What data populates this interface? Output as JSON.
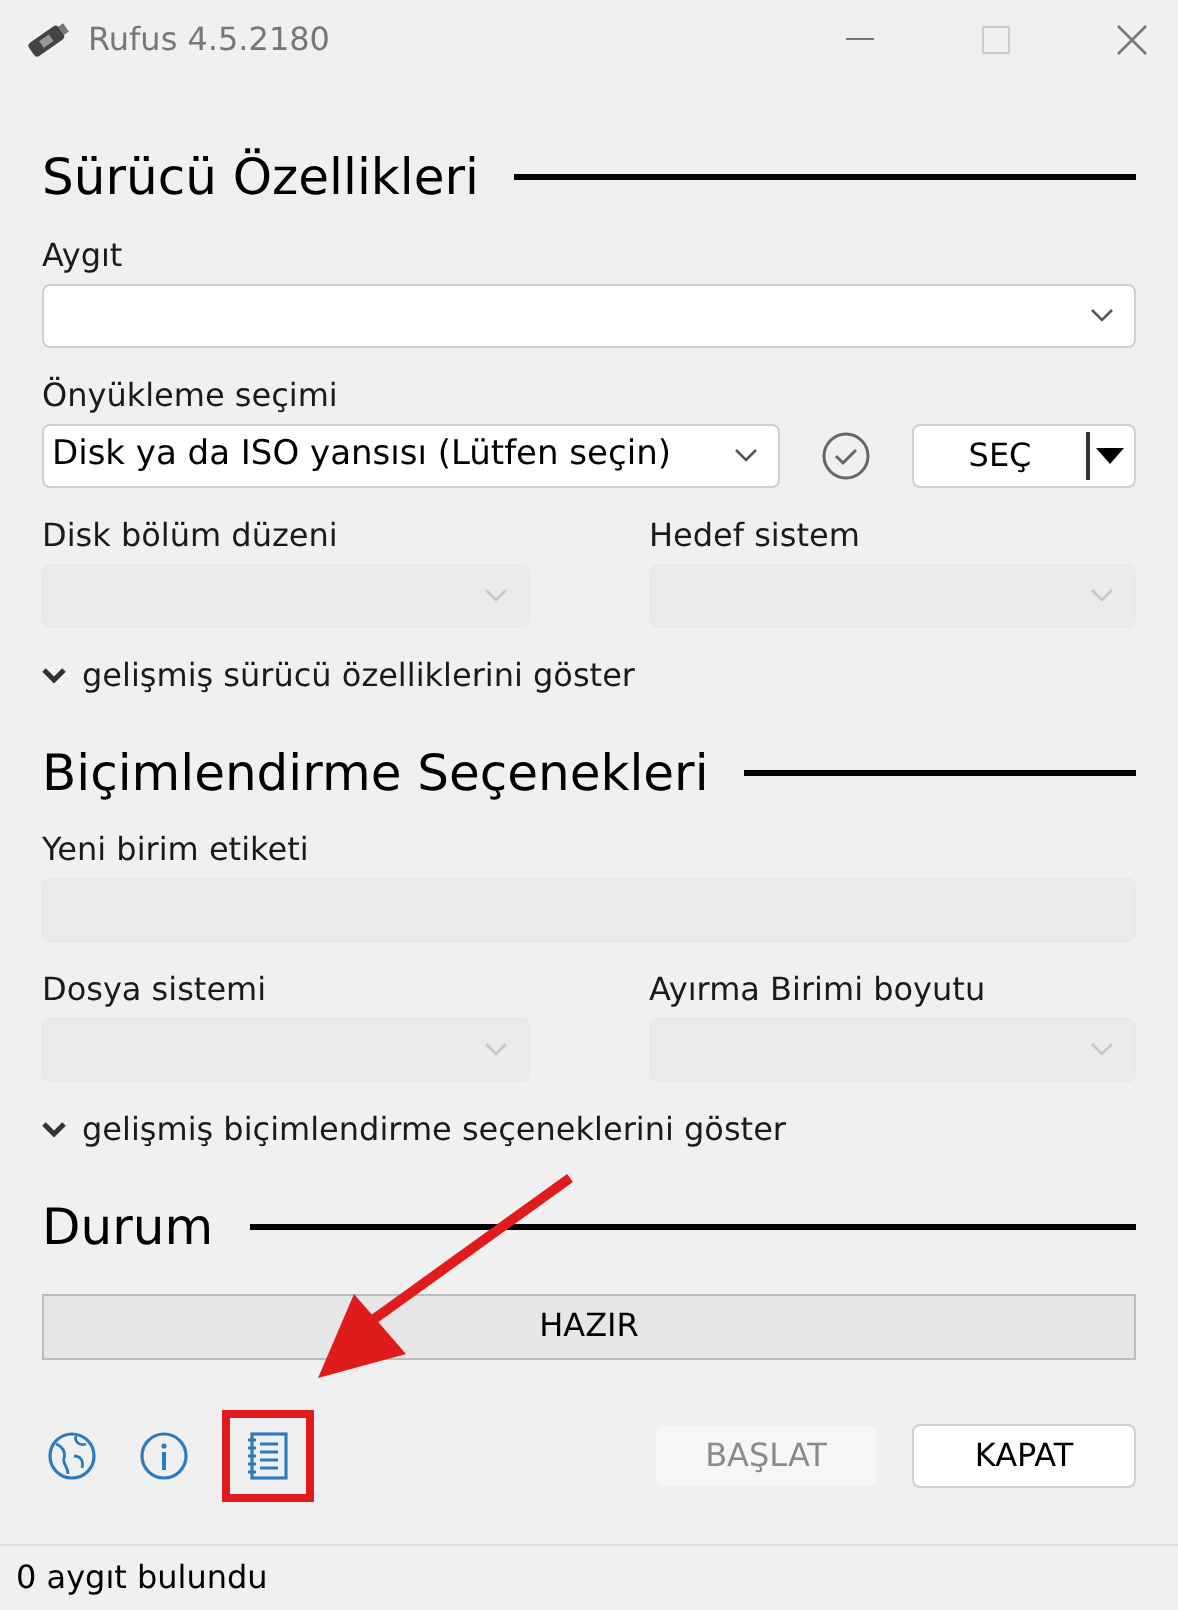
{
  "window": {
    "title": "Rufus 4.5.2180"
  },
  "sections": [
    {
      "title": "Sürücü Özellikleri",
      "rows": [
        [
          {
            "label": "Aygıt",
            "disabled": false,
            "kind": "select"
          }
        ],
        [
          {
            "label": "Önyükleme seçimi",
            "value": "Disk ya da ISO yansısı (Lütfen seçin)",
            "disabled": false,
            "kind": "boot"
          }
        ],
        [
          {
            "label": "Disk bölüm düzeni",
            "disabled": true,
            "kind": "select"
          },
          {
            "label": "Hedef sistem",
            "disabled": true,
            "kind": "select"
          }
        ]
      ],
      "advanced": "gelişmiş sürücü özelliklerini göster"
    },
    {
      "title": "Biçimlendirme Seçenekleri",
      "rows": [
        [
          {
            "label": "Yeni birim etiketi",
            "disabled": true,
            "kind": "text"
          }
        ],
        [
          {
            "label": "Dosya sistemi",
            "disabled": true,
            "kind": "select"
          },
          {
            "label": "Ayırma Birimi boyutu",
            "disabled": true,
            "kind": "select"
          }
        ]
      ],
      "advanced": "gelişmiş biçimlendirme seçeneklerini göster"
    }
  ],
  "select_button": {
    "label": "SEÇ"
  },
  "status": {
    "title": "Durum",
    "text": "HAZIR"
  },
  "buttons": [
    {
      "label": "BAŞLAT",
      "disabled": true
    },
    {
      "label": "KAPAT",
      "disabled": false
    }
  ],
  "status_bar": "0 aygıt bulundu",
  "annotation": {
    "highlight": true,
    "arrow": true
  }
}
